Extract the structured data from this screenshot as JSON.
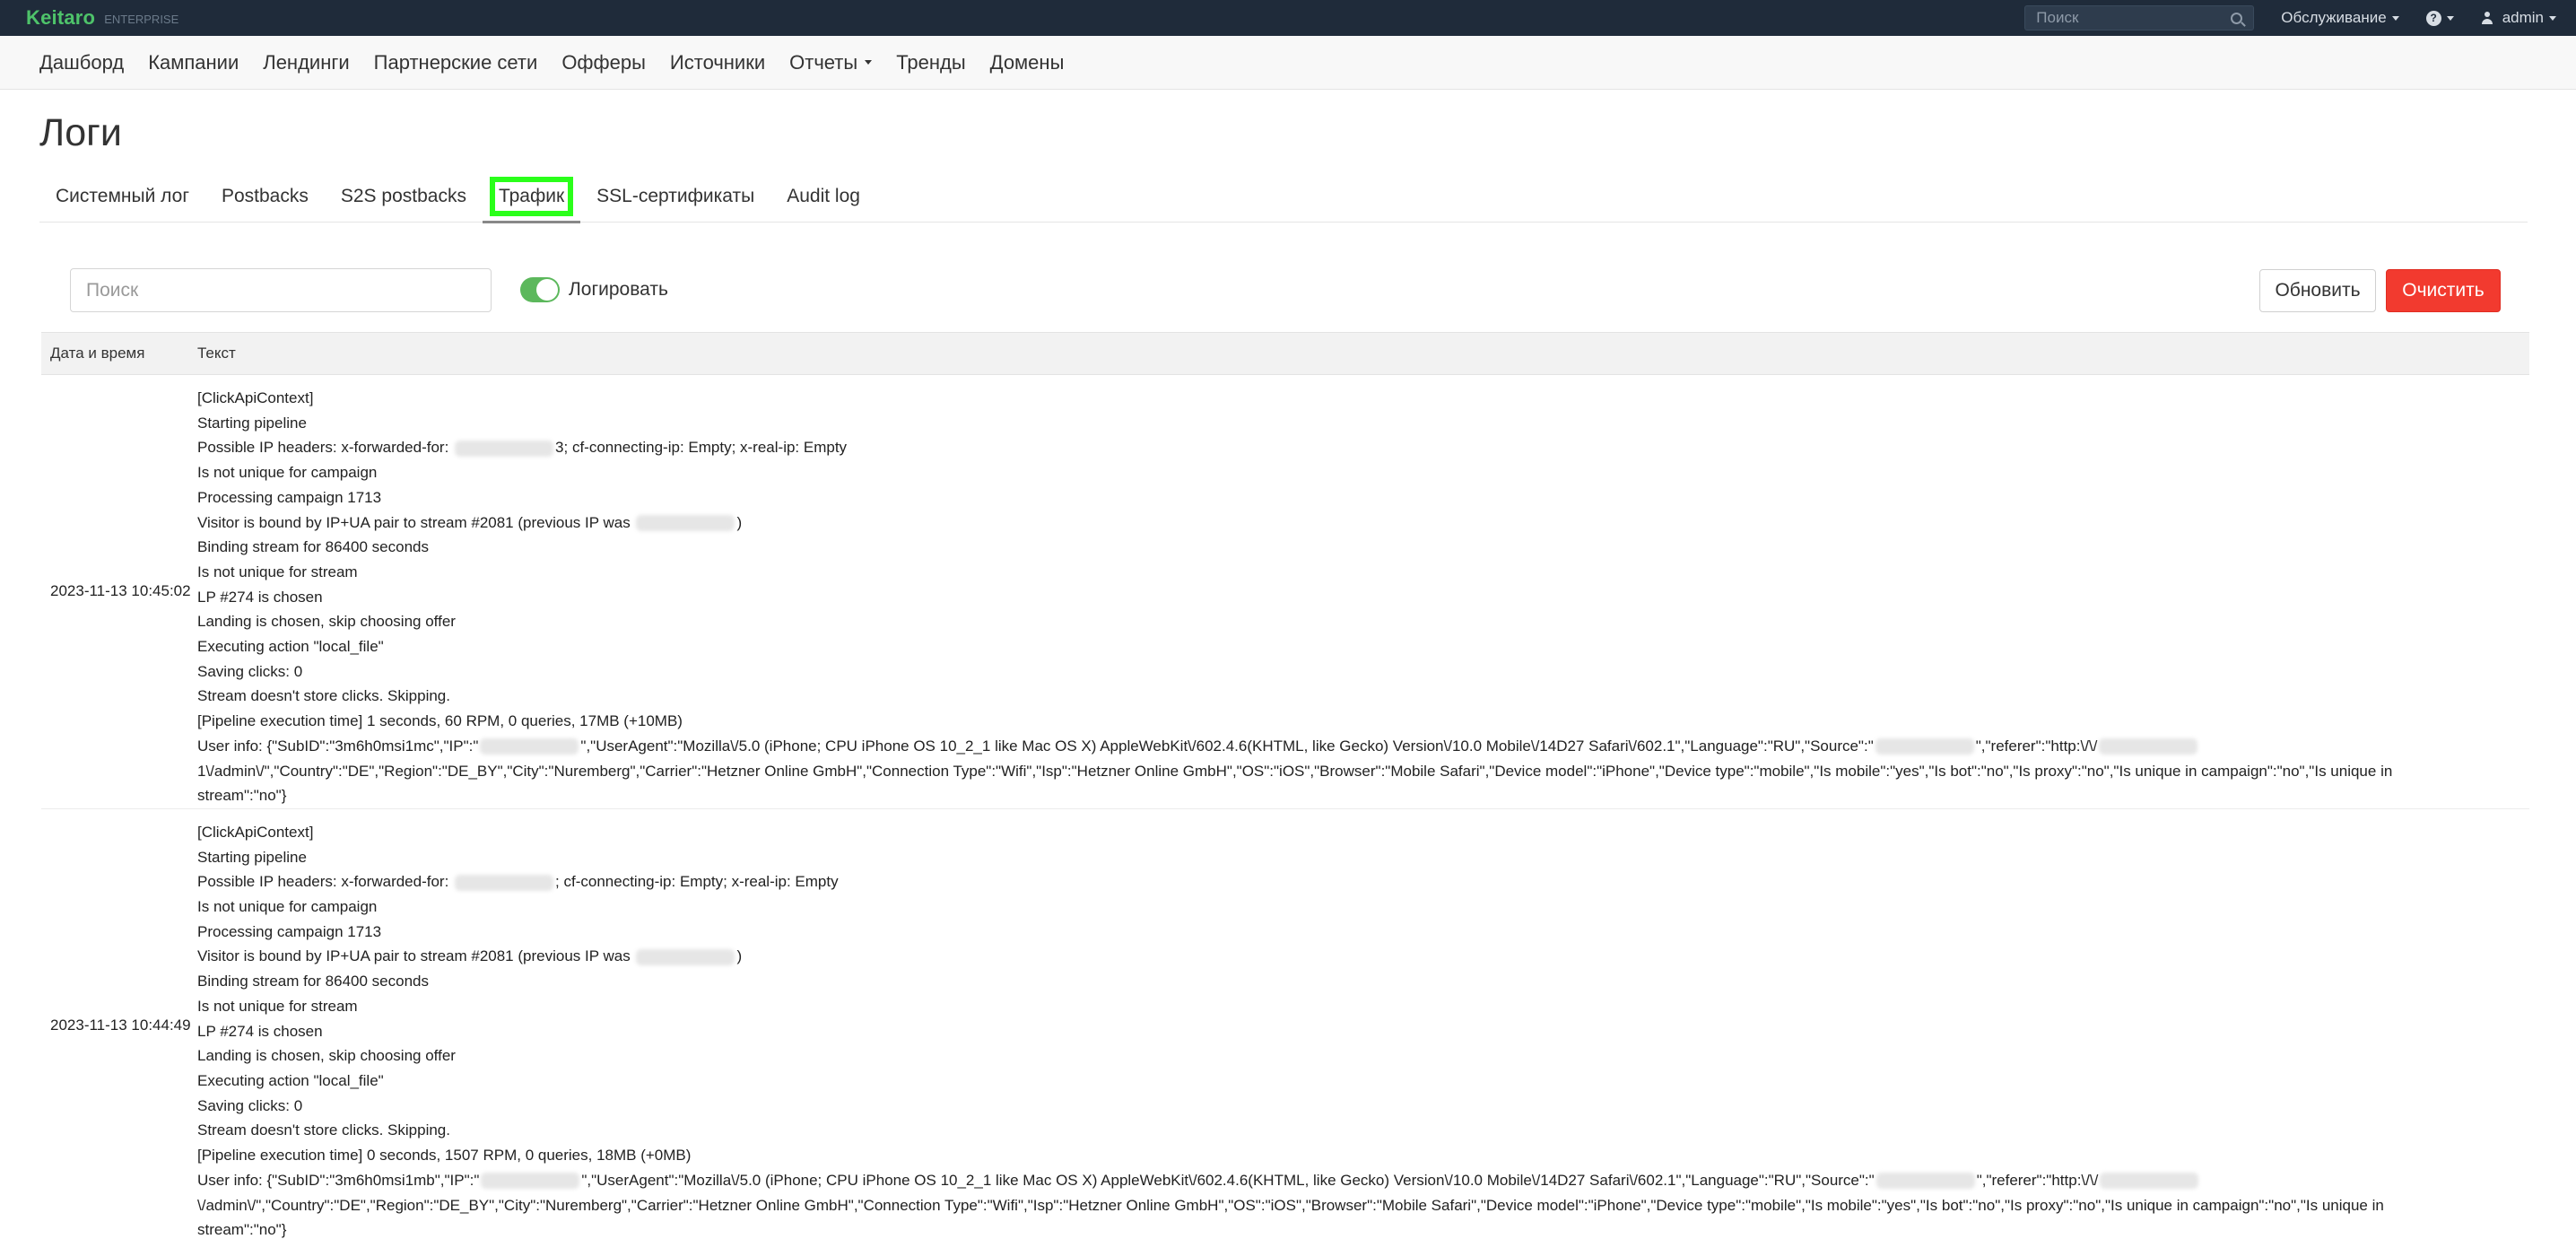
{
  "topbar": {
    "logo": "Keitaro",
    "edition": "ENTERPRISE",
    "search_placeholder": "Поиск",
    "service_menu": "Обслуживание",
    "help_label": "?",
    "user": "admin"
  },
  "nav": {
    "items": [
      "Дашборд",
      "Кампании",
      "Лендинги",
      "Партнерские сети",
      "Офферы",
      "Источники",
      "Отчеты",
      "Тренды",
      "Домены"
    ]
  },
  "page": {
    "title": "Логи",
    "tabs": [
      "Системный лог",
      "Postbacks",
      "S2S postbacks",
      "Трафик",
      "SSL-сертификаты",
      "Audit log"
    ],
    "active_tab": "Трафик"
  },
  "toolbar": {
    "search_placeholder": "Поиск",
    "toggle_label": "Логировать",
    "toggle_on": true,
    "refresh_label": "Обновить",
    "clear_label": "Очистить"
  },
  "table": {
    "headers": {
      "date": "Дата и время",
      "text": "Текст"
    },
    "rows": [
      {
        "date": "2023-11-13 10:45:02",
        "lines": [
          "[ClickApiContext]",
          "Starting pipeline",
          [
            "Possible IP headers: x-forwarded-for: ",
            "3; cf-connecting-ip: Empty; x-real-ip: Empty"
          ],
          "Is not unique for campaign",
          "Processing campaign 1713",
          [
            "Visitor is bound by IP+UA pair to stream #2081 (previous IP was ",
            ")"
          ],
          "Binding stream for 86400 seconds",
          "Is not unique for stream",
          "LP #274 is chosen",
          "Landing is chosen, skip choosing offer",
          "Executing action \"local_file\"",
          "Saving clicks: 0",
          "Stream doesn't store clicks. Skipping.",
          "[Pipeline execution time] 1 seconds, 60 RPM, 0 queries, 17MB (+10MB)"
        ],
        "user_info": [
          "User info: {\"SubID\":\"3m6h0msi1mc\",\"IP\":\"",
          "\",\"UserAgent\":\"Mozilla\\/5.0 (iPhone; CPU iPhone OS 10_2_1 like Mac OS X) AppleWebKit\\/602.4.6(KHTML, like Gecko) Version\\/10.0 Mobile\\/14D27 Safari\\/602.1\",\"Language\":\"RU\",\"Source\":\"",
          "\",\"referer\":\"http:\\/\\/",
          "1\\/admin\\/\",\"Country\":\"DE\",\"Region\":\"DE_BY\",\"City\":\"Nuremberg\",\"Carrier\":\"Hetzner Online GmbH\",\"Connection Type\":\"Wifi\",\"Isp\":\"Hetzner Online GmbH\",\"OS\":\"iOS\",\"Browser\":\"Mobile Safari\",\"Device model\":\"iPhone\",\"Device type\":\"mobile\",\"Is mobile\":\"yes\",\"Is bot\":\"no\",\"Is proxy\":\"no\",\"Is unique in campaign\":\"no\",\"Is unique in stream\":\"no\"}"
        ]
      },
      {
        "date": "2023-11-13 10:44:49",
        "lines": [
          "[ClickApiContext]",
          "Starting pipeline",
          [
            "Possible IP headers: x-forwarded-for: ",
            "; cf-connecting-ip: Empty; x-real-ip: Empty"
          ],
          "Is not unique for campaign",
          "Processing campaign 1713",
          [
            "Visitor is bound by IP+UA pair to stream #2081 (previous IP was ",
            ")"
          ],
          "Binding stream for 86400 seconds",
          "Is not unique for stream",
          "LP #274 is chosen",
          "Landing is chosen, skip choosing offer",
          "Executing action \"local_file\"",
          "Saving clicks: 0",
          "Stream doesn't store clicks. Skipping.",
          "[Pipeline execution time] 0 seconds, 1507 RPM, 0 queries, 18MB (+0MB)"
        ],
        "user_info": [
          "User info: {\"SubID\":\"3m6h0msi1mb\",\"IP\":\"",
          "\",\"UserAgent\":\"Mozilla\\/5.0 (iPhone; CPU iPhone OS 10_2_1 like Mac OS X) AppleWebKit\\/602.4.6(KHTML, like Gecko) Version\\/10.0 Mobile\\/14D27 Safari\\/602.1\",\"Language\":\"RU\",\"Source\":\"",
          "\",\"referer\":\"http:\\/\\/",
          "\\/admin\\/\",\"Country\":\"DE\",\"Region\":\"DE_BY\",\"City\":\"Nuremberg\",\"Carrier\":\"Hetzner Online GmbH\",\"Connection Type\":\"Wifi\",\"Isp\":\"Hetzner Online GmbH\",\"OS\":\"iOS\",\"Browser\":\"Mobile Safari\",\"Device model\":\"iPhone\",\"Device type\":\"mobile\",\"Is mobile\":\"yes\",\"Is bot\":\"no\",\"Is proxy\":\"no\",\"Is unique in campaign\":\"no\",\"Is unique in stream\":\"no\"}"
        ]
      }
    ]
  },
  "colors": {
    "topbar_bg": "#1f2b3a",
    "logo": "#4ec36a",
    "toggle_on": "#5cb85c",
    "danger": "#f23a2f",
    "highlight": "#2aff1a"
  }
}
